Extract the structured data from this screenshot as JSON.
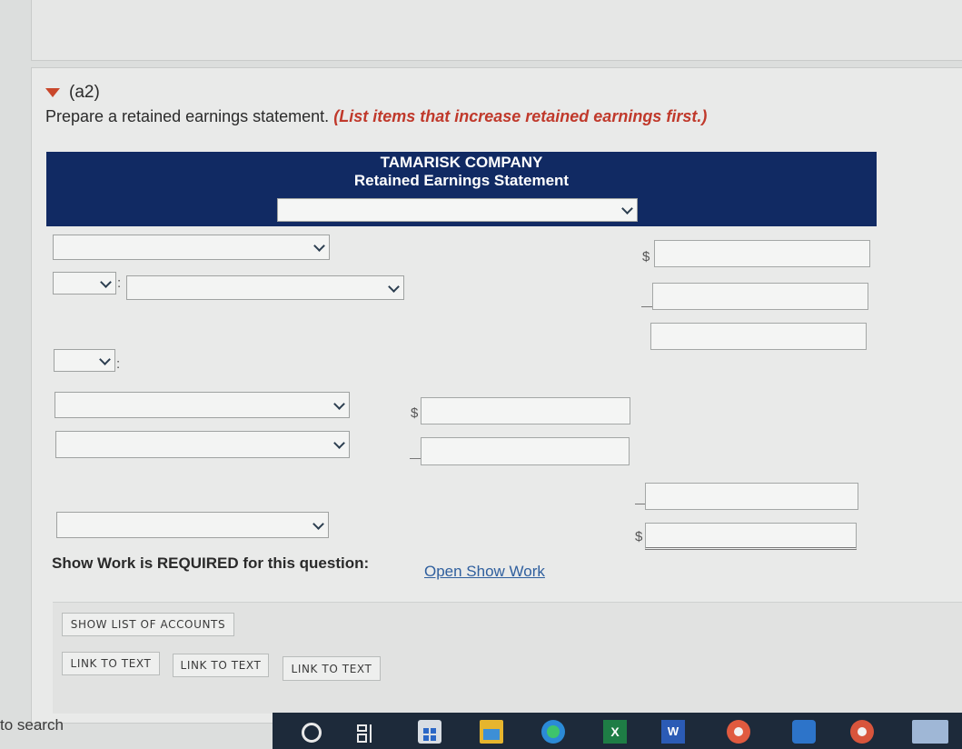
{
  "section": {
    "label": "(a2)",
    "instruction_prefix": "Prepare a retained earnings statement. ",
    "instruction_emphasis": "(List items that increase retained earnings first.)"
  },
  "statement": {
    "company": "TAMARISK COMPANY",
    "title": "Retained Earnings Statement"
  },
  "currency_symbol": "$",
  "colon": ":",
  "show_work": {
    "label": "Show Work is REQUIRED for this question:",
    "link": "Open Show Work"
  },
  "buttons": {
    "show_list": "SHOW LIST OF ACCOUNTS",
    "link_to_text": [
      "LINK TO TEXT",
      "LINK TO TEXT",
      "LINK TO TEXT"
    ]
  },
  "taskbar": {
    "search_text": "to search",
    "apps": [
      "cortana-icon",
      "task-view-icon",
      "store-icon",
      "file-explorer-icon",
      "edge-icon",
      "excel-icon",
      "word-icon",
      "chrome-icon",
      "outlook-icon",
      "chrome-alt-icon",
      "mail-icon"
    ],
    "excel_letter": "X",
    "word_letter": "W"
  }
}
